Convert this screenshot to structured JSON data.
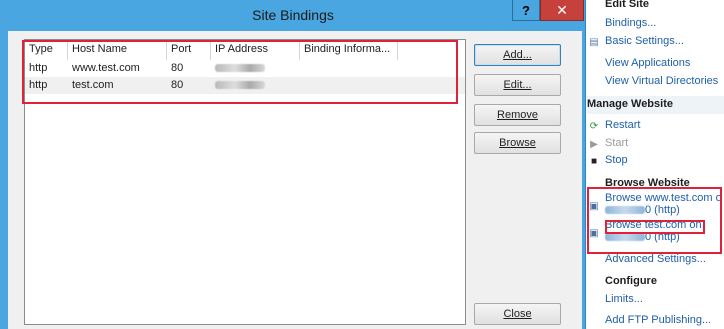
{
  "dialog": {
    "title": "Site Bindings",
    "help_label": "?",
    "close_glyph": "✕",
    "columns": [
      "Type",
      "Host Name",
      "Port",
      "IP Address",
      "Binding Informa..."
    ],
    "rows": [
      {
        "type": "http",
        "host": "www.test.com",
        "port": "80",
        "ip": "",
        "info": ""
      },
      {
        "type": "http",
        "host": "test.com",
        "port": "80",
        "ip": "",
        "info": ""
      }
    ],
    "buttons": {
      "add": "Add...",
      "edit": "Edit...",
      "remove": "Remove",
      "browse": "Browse",
      "close": "Close"
    }
  },
  "actions": {
    "edit_site_heading": "Edit Site",
    "bindings": "Bindings...",
    "basic_settings": "Basic Settings...",
    "view_applications": "View Applications",
    "view_virtual_directories": "View Virtual Directories",
    "manage_heading": "Manage Website",
    "restart": "Restart",
    "start": "Start",
    "stop": "Stop",
    "browse_heading": "Browse Website",
    "browse_www_line1": "Browse www.test.com o",
    "browse_www_line2": "0 (http)",
    "browse_test_line1": "Browse test.com on",
    "browse_test_line2": "0 (http)",
    "advanced_settings": "Advanced Settings...",
    "configure_heading": "Configure",
    "limits": "Limits...",
    "add_ftp": "Add FTP Publishing..."
  },
  "icons": {
    "restart": "restart-icon",
    "start": "start-icon",
    "stop": "stop-icon",
    "browse": "browse-icon",
    "basic_settings": "settings-icon"
  },
  "colors": {
    "title_bar": "#4aa6e0",
    "close_button": "#c7413c",
    "link": "#1f5fa8",
    "highlight": "#e0213a"
  }
}
